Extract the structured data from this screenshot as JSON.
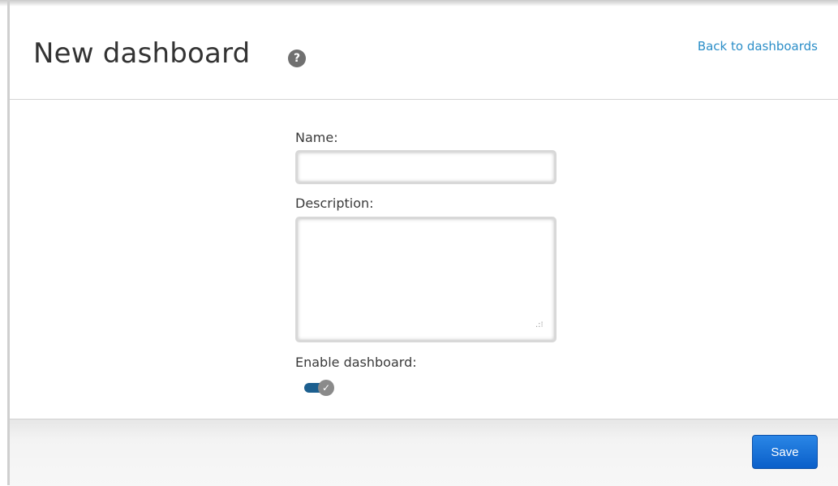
{
  "header": {
    "title": "New dashboard",
    "help_icon": "?",
    "back_link": "Back to dashboards"
  },
  "form": {
    "name_label": "Name:",
    "name_value": "",
    "description_label": "Description:",
    "description_value": "",
    "enable_label": "Enable dashboard:",
    "enabled": true
  },
  "footer": {
    "save_label": "Save"
  },
  "colors": {
    "link": "#2b8ec8",
    "toggle_track": "#1c5f8f",
    "save_button": "#0a5fc9"
  }
}
